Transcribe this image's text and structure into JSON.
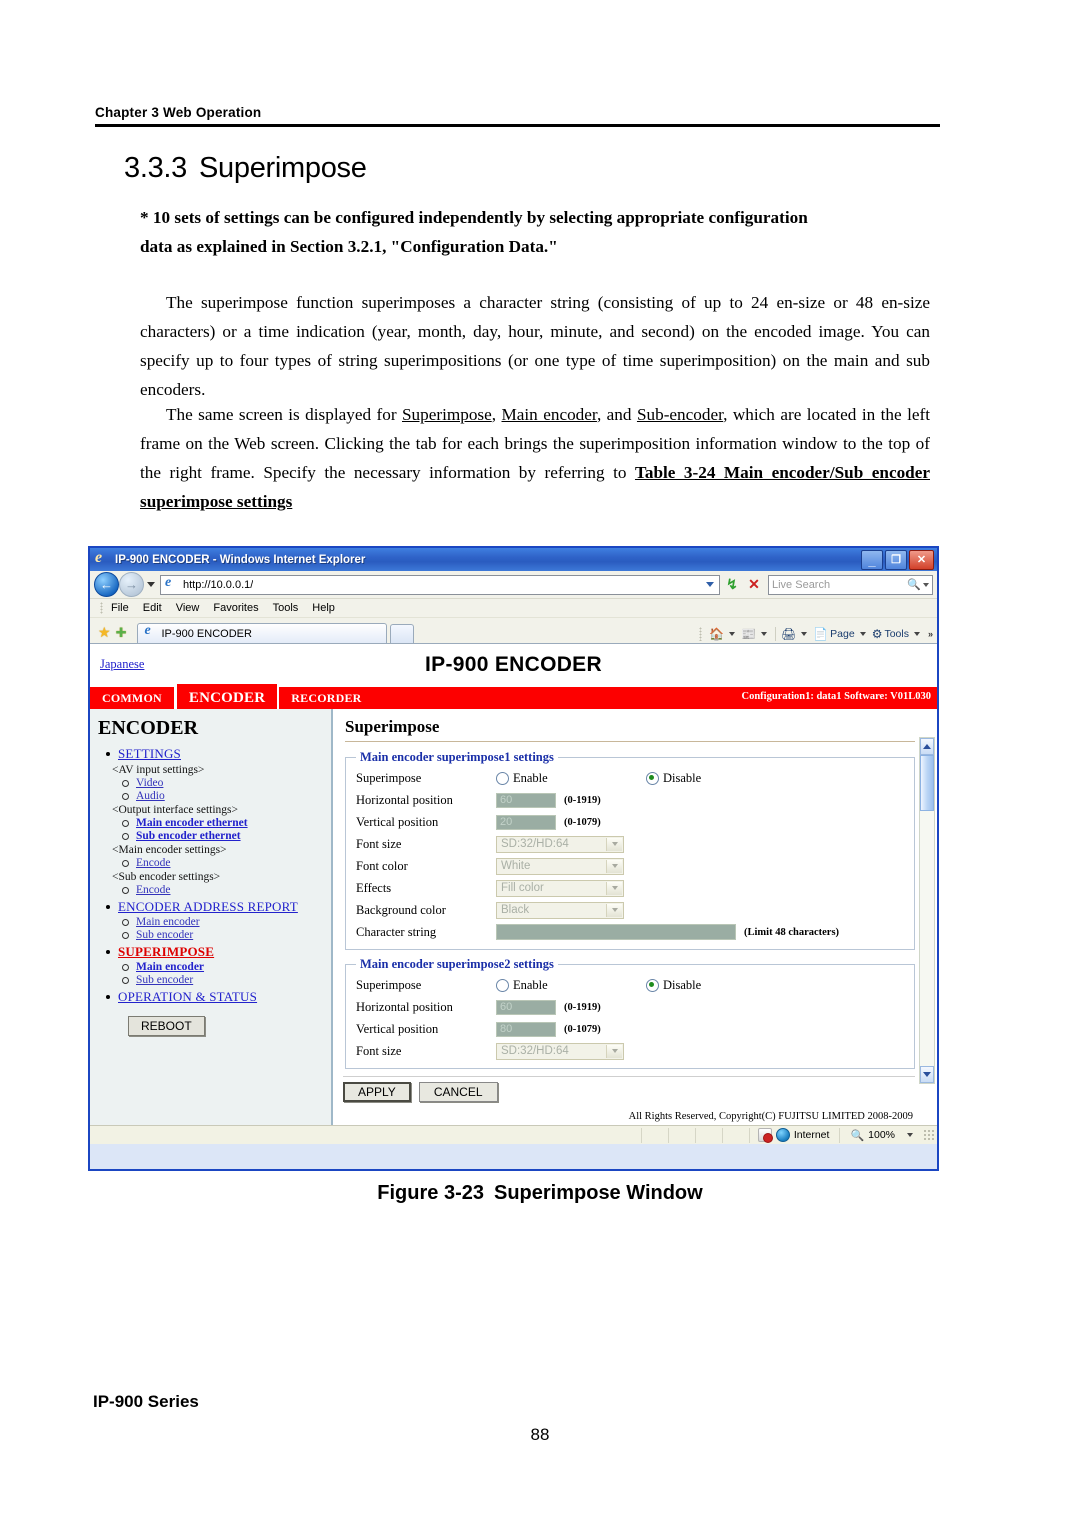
{
  "document": {
    "running_head": "Chapter 3  Web Operation",
    "section_number": "3.3.3",
    "section_title": "Superimpose",
    "note_line1": "* 10 sets of settings can be configured independently by selecting appropriate configuration",
    "note_line2": "data as explained in Section 3.2.1, \"Configuration Data.\"",
    "paragraph_1": "The superimpose function superimposes a character string (consisting of up to 24 en-size or 48 en-size characters) or a time indication (year, month, day, hour, minute, and second) on the encoded image.  You can specify up to four types of string superimpositions (or one type of time superimposition) on the main and sub encoders.",
    "paragraph_2_part1": "The same screen is displayed for ",
    "paragraph_2_u1": "Superimpose",
    "paragraph_2_part2": ", ",
    "paragraph_2_u2": "Main encoder",
    "paragraph_2_part3": ", and ",
    "paragraph_2_u3": "Sub-encoder",
    "paragraph_2_part4": ", which are located in the left frame on the Web screen.  Clicking the tab for each brings the superimposition information window to the top of the right frame.  Specify the necessary information by referring to ",
    "paragraph_2_ref": "Table 3-24 Main encoder/Sub encoder superimpose settings",
    "figure_caption_label": "Figure 3-23",
    "figure_caption_title": "Superimpose Window",
    "footer_left": "IP-900 Series",
    "footer_page": "88"
  },
  "browser": {
    "window_title": "IP-900 ENCODER - Windows Internet Explorer",
    "minimize_glyph": "_",
    "maximize_glyph": "❐",
    "close_glyph": "✕",
    "back_glyph": "←",
    "forward_glyph": "→",
    "address_url": "http://10.0.0.1/",
    "refresh_glyph": "↯",
    "stop_glyph": "✕",
    "search_placeholder": "Live Search",
    "search_icon": "search-icon",
    "menus": [
      "File",
      "Edit",
      "View",
      "Favorites",
      "Tools",
      "Help"
    ],
    "favorites_star_icon": "star-icon",
    "add_favorite_icon": "add-favorite-icon",
    "tab_label": "IP-900 ENCODER",
    "command_bar": {
      "home_icon": "home-icon",
      "feeds_icon": "rss-icon",
      "print_icon": "printer-icon",
      "page_label": "Page",
      "tools_label": "Tools",
      "overflow_glyph": "»"
    },
    "status_bar": {
      "zone_label": "Internet",
      "zoom_label": "100%",
      "protected_icon": "protected-mode-icon",
      "globe_icon": "internet-zone-icon",
      "zoom_icon": "zoom-icon"
    }
  },
  "webpage": {
    "language_link": "Japanese",
    "banner_title": "IP-900 ENCODER",
    "tabs": [
      {
        "label": "COMMON",
        "active": false
      },
      {
        "label": "ENCODER",
        "active": true
      },
      {
        "label": "RECORDER",
        "active": false
      }
    ],
    "config_status": "Configuration1: data1 Software: V01L030",
    "nav": {
      "title": "ENCODER",
      "items": [
        {
          "type": "link",
          "label": "SETTINGS",
          "current": false
        },
        {
          "type": "group",
          "label": "<AV input settings>"
        },
        {
          "type": "sub",
          "label": "Video",
          "bold": false
        },
        {
          "type": "sub",
          "label": "Audio",
          "bold": false
        },
        {
          "type": "group",
          "label": "<Output interface settings>"
        },
        {
          "type": "sub",
          "label": "Main encoder ethernet",
          "bold": true
        },
        {
          "type": "sub",
          "label": "Sub encoder ethernet",
          "bold": true
        },
        {
          "type": "group",
          "label": "<Main encoder settings>"
        },
        {
          "type": "sub",
          "label": "Encode",
          "bold": false
        },
        {
          "type": "group",
          "label": "<Sub encoder settings>"
        },
        {
          "type": "sub",
          "label": "Encode",
          "bold": false
        },
        {
          "type": "link",
          "label": "ENCODER ADDRESS REPORT",
          "current": false
        },
        {
          "type": "sub",
          "label": "Main encoder",
          "bold": false
        },
        {
          "type": "sub",
          "label": "Sub encoder",
          "bold": false
        },
        {
          "type": "link",
          "label": "SUPERIMPOSE",
          "current": true
        },
        {
          "type": "sub",
          "label": "Main encoder",
          "bold": true
        },
        {
          "type": "sub",
          "label": "Sub encoder",
          "bold": false
        },
        {
          "type": "link",
          "label": "OPERATION & STATUS",
          "current": false
        }
      ],
      "reboot_label": "REBOOT"
    },
    "content": {
      "title": "Superimpose",
      "groups": [
        {
          "legend": "Main encoder superimpose1 settings",
          "rows": [
            {
              "kind": "radio",
              "label": "Superimpose",
              "option1": "Enable",
              "option2": "Disable",
              "selected": "Disable"
            },
            {
              "kind": "text",
              "label": "Horizontal position",
              "value": "60",
              "hint": "(0-1919)"
            },
            {
              "kind": "text",
              "label": "Vertical position",
              "value": "20",
              "hint": "(0-1079)"
            },
            {
              "kind": "select",
              "label": "Font size",
              "value": "SD:32/HD:64"
            },
            {
              "kind": "select",
              "label": "Font color",
              "value": "White"
            },
            {
              "kind": "select",
              "label": "Effects",
              "value": "Fill color"
            },
            {
              "kind": "select",
              "label": "Background color",
              "value": "Black"
            },
            {
              "kind": "wide",
              "label": "Character string",
              "value": "",
              "hint": "(Limit 48 characters)"
            }
          ]
        },
        {
          "legend": "Main encoder superimpose2 settings",
          "rows": [
            {
              "kind": "radio",
              "label": "Superimpose",
              "option1": "Enable",
              "option2": "Disable",
              "selected": "Disable"
            },
            {
              "kind": "text",
              "label": "Horizontal position",
              "value": "60",
              "hint": "(0-1919)"
            },
            {
              "kind": "text",
              "label": "Vertical position",
              "value": "80",
              "hint": "(0-1079)"
            },
            {
              "kind": "select",
              "label": "Font size",
              "value": "SD:32/HD:64"
            }
          ]
        }
      ],
      "apply_label": "APPLY",
      "cancel_label": "CANCEL",
      "copyright": "All Rights Reserved, Copyright(C) FUJITSU LIMITED 2008-2009"
    }
  }
}
